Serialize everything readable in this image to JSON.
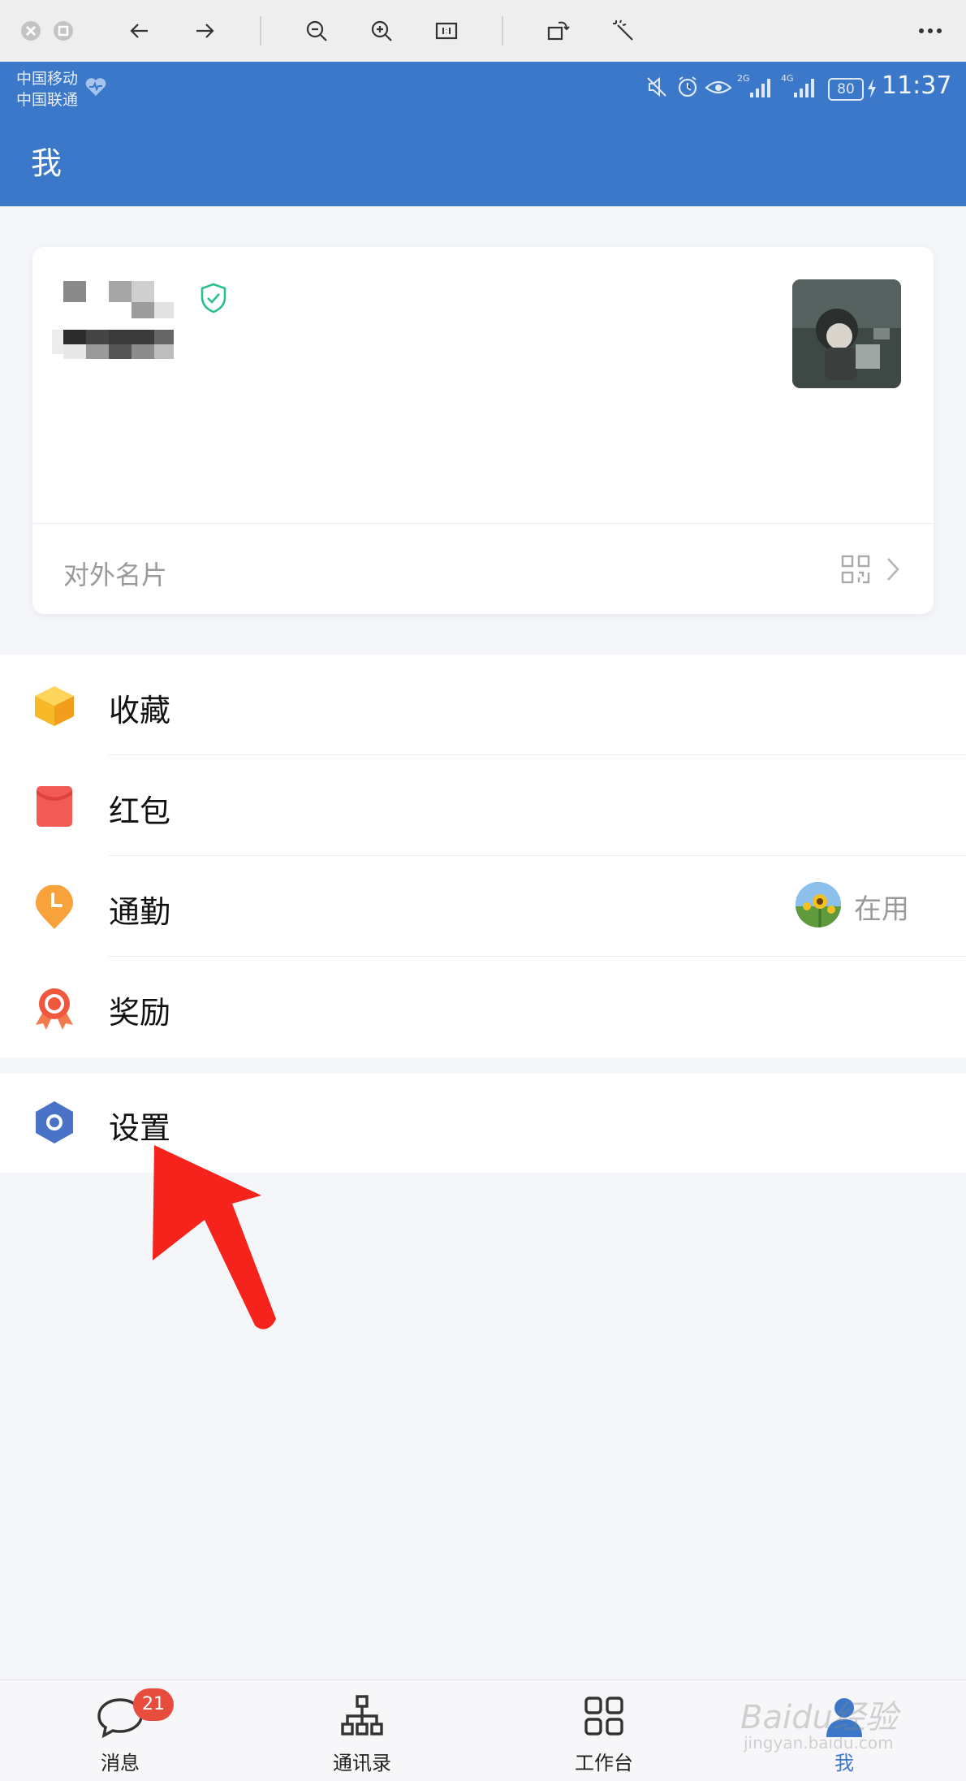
{
  "colors": {
    "brand_blue": "#3b78c9",
    "badge_red": "#e84c3d",
    "arrow_red": "#f5231b",
    "shield_green": "#2bbf8e"
  },
  "status_bar": {
    "carrier_1": "中国移动",
    "carrier_2": "中国联通",
    "battery": "80",
    "time": "11:37",
    "signal_1": "2G",
    "signal_2": "4G"
  },
  "header": {
    "title": "我"
  },
  "profile": {
    "card_link_label": "对外名片"
  },
  "menu": {
    "favorites": "收藏",
    "red_packet": "红包",
    "attendance": "通勤",
    "attendance_status": "在用",
    "rewards": "奖励",
    "settings": "设置"
  },
  "bottom_nav": {
    "messages": "消息",
    "messages_badge": "21",
    "contacts": "通讯录",
    "workbench": "工作台",
    "me": "我"
  },
  "watermark": {
    "brand": "Baidu经验",
    "url": "jingyan.baidu.com"
  },
  "icons": [
    "close-icon",
    "restore-icon",
    "back-arrow-icon",
    "forward-arrow-icon",
    "zoom-out-icon",
    "zoom-in-icon",
    "actual-size-icon",
    "rotate-icon",
    "magic-wand-icon",
    "more-icon",
    "shield-check-icon",
    "qr-code-icon",
    "chevron-right-icon",
    "box-icon",
    "red-packet-icon",
    "clock-pin-icon",
    "medal-icon",
    "settings-hexagon-icon",
    "chat-icon",
    "org-chart-icon",
    "grid-icon",
    "person-icon"
  ]
}
